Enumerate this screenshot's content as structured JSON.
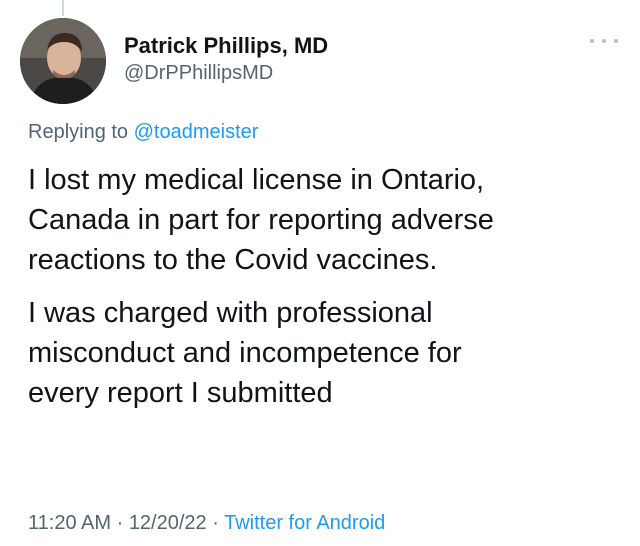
{
  "author": {
    "display_name": "Patrick Phillips, MD",
    "handle": "@DrPPhillipsMD"
  },
  "reply": {
    "prefix": "Replying to ",
    "mention": "@toadmeister"
  },
  "tweet": {
    "paragraphs": [
      "I lost my medical license in Ontario,\nCanada in part for reporting adverse\nreactions to the Covid vaccines.",
      "I was charged with professional\nmisconduct and incompetence for\nevery report I submitted"
    ]
  },
  "footer": {
    "time": "11:20 AM",
    "separator": " · ",
    "date": "12/20/22",
    "source": "Twitter for Android"
  },
  "icons": {
    "more": "more-horizontal-icon",
    "avatar": "user-avatar"
  },
  "colors": {
    "link": "#1d9bf0",
    "secondary_text": "#536471",
    "primary_text": "#0f1419"
  }
}
